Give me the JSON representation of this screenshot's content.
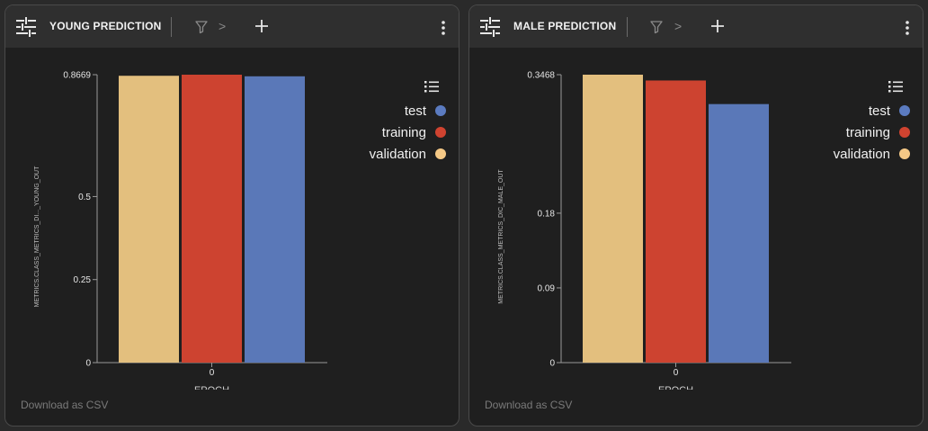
{
  "panels": [
    {
      "title": "YOUNG PREDICTION",
      "breadcrumb_separator": ">",
      "download_label": "Download as CSV",
      "legend": [
        {
          "label": "test",
          "color": "#5b7bc0"
        },
        {
          "label": "training",
          "color": "#d04330"
        },
        {
          "label": "validation",
          "color": "#f6c986"
        }
      ]
    },
    {
      "title": "MALE PREDICTION",
      "breadcrumb_separator": ">",
      "download_label": "Download as CSV",
      "legend": [
        {
          "label": "test",
          "color": "#5b7bc0"
        },
        {
          "label": "training",
          "color": "#d04330"
        },
        {
          "label": "validation",
          "color": "#f6c986"
        }
      ]
    }
  ],
  "chart_data": [
    {
      "type": "bar",
      "title": "YOUNG PREDICTION",
      "xlabel": "EPOCH",
      "ylabel": "METRICS.CLASS_METRICS_DI..._YOUNG_OUT",
      "categories": [
        "0"
      ],
      "series": [
        {
          "name": "validation",
          "values": [
            0.8636
          ],
          "color": "#e3bf7e"
        },
        {
          "name": "training",
          "values": [
            0.8669
          ],
          "color": "#cd4330"
        },
        {
          "name": "test",
          "values": [
            0.862
          ],
          "color": "#5a78b8"
        }
      ],
      "yticks": [
        0,
        0.25,
        0.5,
        0.8669
      ],
      "ytick_labels": [
        "0",
        "0.25",
        "0.5",
        "0.8669"
      ],
      "ylim": [
        0,
        0.8669
      ],
      "legend_position": "top-right"
    },
    {
      "type": "bar",
      "title": "MALE PREDICTION",
      "xlabel": "EPOCH",
      "ylabel": "METRICS.CLASS_METRICS_DIC_MALE_OUT",
      "categories": [
        "0"
      ],
      "series": [
        {
          "name": "validation",
          "values": [
            0.3468
          ],
          "color": "#e3bf7e"
        },
        {
          "name": "training",
          "values": [
            0.3398
          ],
          "color": "#cd4330"
        },
        {
          "name": "test",
          "values": [
            0.3114
          ],
          "color": "#5a78b8"
        }
      ],
      "yticks": [
        0,
        0.09,
        0.18,
        0.3468
      ],
      "ytick_labels": [
        "0",
        "0.09",
        "0.18",
        "0.3468"
      ],
      "ylim": [
        0,
        0.3468
      ],
      "legend_position": "top-right"
    }
  ]
}
